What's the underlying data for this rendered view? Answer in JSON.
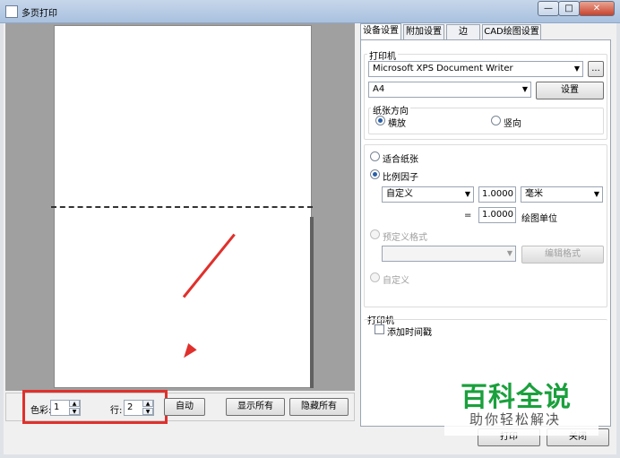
{
  "window": {
    "title": "多页打印",
    "minimize": "—",
    "maximize": "□",
    "close": "✕"
  },
  "preview": {},
  "bottom": {
    "color_label": "色彩:",
    "color_value": "1",
    "row_label": "行:",
    "row_value": "2",
    "auto_button": "自动",
    "show_all_button": "显示所有",
    "hide_all_button": "隐藏所有"
  },
  "tabs": [
    "设备设置",
    "附加设置",
    "边",
    "CAD绘图设置"
  ],
  "printer_section": {
    "title": "打印机",
    "printer_name": "Microsoft XPS Document Writer",
    "more_button": "...",
    "paper_size": "A4",
    "settings_button": "设置",
    "orientation_title": "纸张方向",
    "landscape": "横放",
    "portrait": "竖向"
  },
  "scale_section": {
    "fit_paper": "适合纸张",
    "scale_factor": "比例因子",
    "scale_combo": "自定义",
    "scale_value1": "1.0000",
    "unit_combo": "毫米",
    "equals": "=",
    "scale_value2": "1.0000",
    "drawing_unit": "绘图单位",
    "predefined_format": "预定义格式",
    "edit_format_button": "编辑格式",
    "custom": "自定义"
  },
  "stamp_section": {
    "title": "打印机",
    "add_timestamp": "添加时间戳"
  },
  "footer": {
    "print_button": "打印",
    "close_button": "关闭"
  },
  "watermark": {
    "title": "百科全说",
    "subtitle": "助你轻松解决"
  },
  "colors": {
    "annotation": "#e0302c",
    "watermark": "#1aa03c",
    "radio_selected": "#2a5fa8"
  }
}
